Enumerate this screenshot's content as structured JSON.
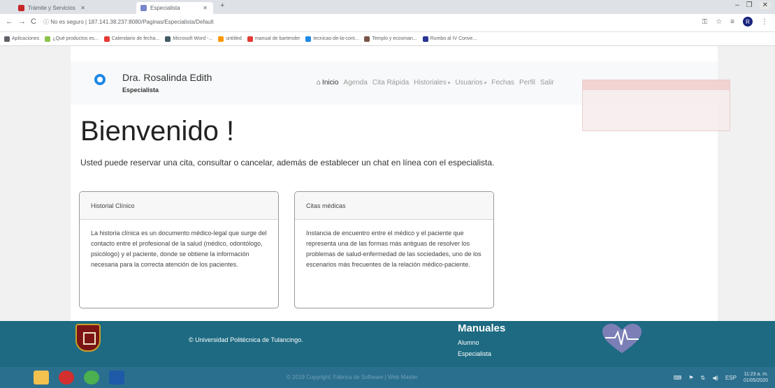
{
  "browser": {
    "tabs": [
      {
        "title": "Trámite y Servicios",
        "fav_color": "#c62828"
      },
      {
        "title": "Especialista",
        "fav_color": "#7986cb"
      }
    ],
    "new_tab": "+",
    "window_controls": [
      "–",
      "❐",
      "✕"
    ],
    "nav": {
      "back": "←",
      "forward": "→",
      "reload": "C"
    },
    "url_warning": "ⓘ No es seguro",
    "url": "187.141.38.237:8080/Paginas/Especialista/Default",
    "profile_initial": "R",
    "bookmarks": [
      {
        "label": "Aplicaciones",
        "color": "#5f6368"
      },
      {
        "label": "¿Qué productos es...",
        "color": "#8bc34a"
      },
      {
        "label": "Calendario de fecha...",
        "color": "#e53935"
      },
      {
        "label": "Microsoft Word -...",
        "color": "#455a64"
      },
      {
        "label": "untitled",
        "color": "#ff9800"
      },
      {
        "label": "manual de bartender",
        "color": "#e53935"
      },
      {
        "label": "tecnicas-de-la-cont...",
        "color": "#1e88e5"
      },
      {
        "label": "Templo y ecosman...",
        "color": "#795548"
      },
      {
        "label": "Rumbo al IV Conve...",
        "color": "#283593"
      }
    ]
  },
  "navbar": {
    "doctor_name": "Dra. Rosalinda Edith",
    "role": "Especialista",
    "menu": [
      {
        "label": "Inicio",
        "active": true,
        "caret": false
      },
      {
        "label": "Agenda",
        "active": false,
        "caret": false
      },
      {
        "label": "Cita Rápida",
        "active": false,
        "caret": false
      },
      {
        "label": "Historiales",
        "active": false,
        "caret": true
      },
      {
        "label": "Usuarios",
        "active": false,
        "caret": true
      },
      {
        "label": "Fechas",
        "active": false,
        "caret": false
      },
      {
        "label": "Perfil",
        "active": false,
        "caret": false
      },
      {
        "label": "Salir",
        "active": false,
        "caret": false
      }
    ]
  },
  "main": {
    "title": "Bienvenido !",
    "lead": "Usted puede reservar una cita, consultar o cancelar, además de establecer un chat en línea con el especialista.",
    "cards": [
      {
        "header": "Historial Clínico",
        "body": "La historia clínica es un documento médico-legal que surge del contacto entre el profesional de la salud (médico, odontólogo, psicólogo) y el paciente, donde se obtiene la información necesaria para la correcta atención de los pacientes."
      },
      {
        "header": "Citas médicas",
        "body": "Instancia de encuentro entre el médico y el paciente que representa una de las formas más antiguas de resolver los problemas de salud-enfermedad de las sociedades, uno de los escenarios más frecuentes de la relación médico-paciente."
      }
    ]
  },
  "footer": {
    "copyright": "© Universidad Politécnica de Tulancingo.",
    "manuales_title": "Manuales",
    "links": [
      "Alumno",
      "Especialista"
    ],
    "faded_text": "© 2019 Copyright: Fábrica de Software | Web Master"
  },
  "taskbar": {
    "lang": "ESP",
    "time": "11:23 a. m.",
    "date": "01/05/2020"
  },
  "colors": {
    "footer_bg": "#1d6a82",
    "taskbar_bg": "#2b6f8e",
    "brand_icon": "#1e88e5"
  }
}
